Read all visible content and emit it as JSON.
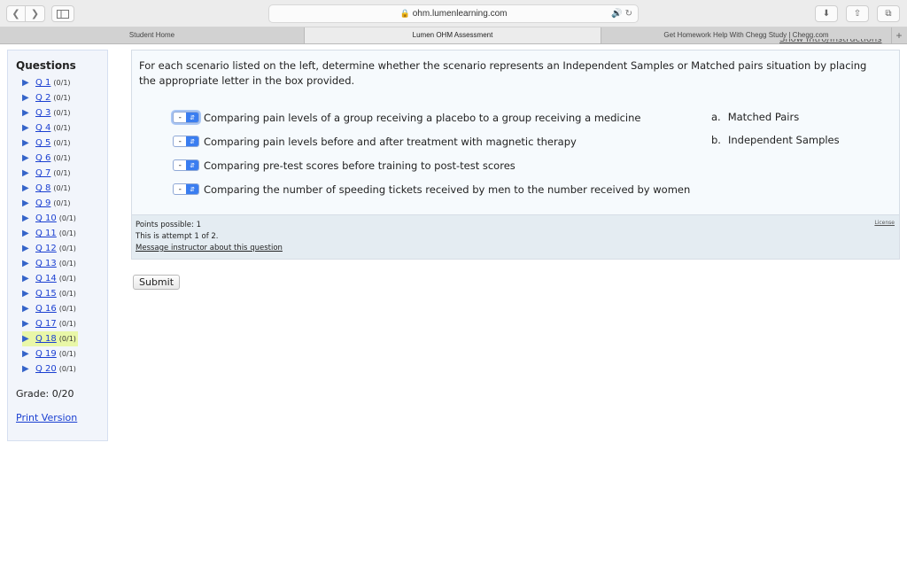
{
  "browser": {
    "url": "ohm.lumenlearning.com",
    "tabs": [
      {
        "label": "Student Home"
      },
      {
        "label": "Lumen OHM Assessment"
      },
      {
        "label": "Get Homework Help With Chegg Study | Chegg.com"
      }
    ],
    "new_tab_label": "+"
  },
  "cut_link": "Show Intro/Instructions",
  "qnav": {
    "title": "Questions",
    "items": [
      {
        "label": "Q 1",
        "score": "(0/1)"
      },
      {
        "label": "Q 2",
        "score": "(0/1)"
      },
      {
        "label": "Q 3",
        "score": "(0/1)"
      },
      {
        "label": "Q 4",
        "score": "(0/1)"
      },
      {
        "label": "Q 5",
        "score": "(0/1)"
      },
      {
        "label": "Q 6",
        "score": "(0/1)"
      },
      {
        "label": "Q 7",
        "score": "(0/1)"
      },
      {
        "label": "Q 8",
        "score": "(0/1)"
      },
      {
        "label": "Q 9",
        "score": "(0/1)"
      },
      {
        "label": "Q 10",
        "score": "(0/1)"
      },
      {
        "label": "Q 11",
        "score": "(0/1)"
      },
      {
        "label": "Q 12",
        "score": "(0/1)"
      },
      {
        "label": "Q 13",
        "score": "(0/1)"
      },
      {
        "label": "Q 14",
        "score": "(0/1)"
      },
      {
        "label": "Q 15",
        "score": "(0/1)"
      },
      {
        "label": "Q 16",
        "score": "(0/1)"
      },
      {
        "label": "Q 17",
        "score": "(0/1)"
      },
      {
        "label": "Q 18",
        "score": "(0/1)"
      },
      {
        "label": "Q 19",
        "score": "(0/1)"
      },
      {
        "label": "Q 20",
        "score": "(0/1)"
      }
    ],
    "current_item": "Q 18",
    "grade": "Grade: 0/20",
    "print_label": "Print Version"
  },
  "question": {
    "prompt": "For each scenario listed on the left, determine whether the scenario represents an Independent Samples or Matched pairs situation by placing the appropriate letter in the box provided.",
    "scenarios": [
      {
        "select_value": "-",
        "text": "Comparing pain levels of a group receiving a placebo to a group receiving a medicine"
      },
      {
        "select_value": "-",
        "text": "Comparing pain levels before and after treatment with magnetic therapy"
      },
      {
        "select_value": "-",
        "text": "Comparing pre-test scores before training to post-test scores"
      },
      {
        "select_value": "-",
        "text": "Comparing the number of speeding tickets received by men to the number received by women"
      }
    ],
    "answers": [
      {
        "letter": "a.",
        "text": "Matched Pairs"
      },
      {
        "letter": "b.",
        "text": "Independent Samples"
      }
    ],
    "points": "Points possible: 1",
    "attempt": "This is attempt 1 of 2.",
    "message_link": "Message instructor about this question",
    "license": "License"
  },
  "submit_label": "Submit",
  "colors": {
    "link": "#1a3fd1",
    "current_highlight": "#e9f7a8",
    "select_accent": "#3a7df0"
  }
}
